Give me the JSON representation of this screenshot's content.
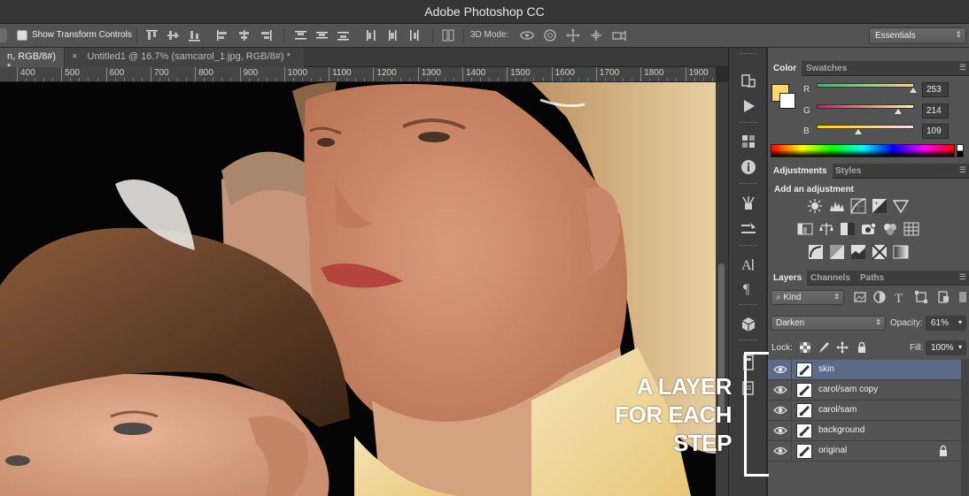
{
  "app": {
    "title": "Adobe Photoshop CC"
  },
  "options_bar": {
    "show_transform_controls": "Show Transform Controls",
    "mode_3d_label": "3D Mode:",
    "workspace": "Essentials"
  },
  "tabs": [
    {
      "label": "n, RGB/8#) *"
    },
    {
      "close": "×",
      "label": "Untitled1 @ 16.7% (samcarol_1.jpg, RGB/8#) *"
    }
  ],
  "ruler": {
    "labels": [
      "400",
      "500",
      "600",
      "700",
      "800",
      "900",
      "1000",
      "1100",
      "1200",
      "1300",
      "1400",
      "1500",
      "1600",
      "1700",
      "1800",
      "1900"
    ]
  },
  "color_panel": {
    "tabs": [
      "Color",
      "Swatches"
    ],
    "foreground": "#fdd66d",
    "background": "#ffffff",
    "channels": [
      {
        "label": "R",
        "value": "253",
        "fraction": 0.99
      },
      {
        "label": "G",
        "value": "214",
        "fraction": 0.84
      },
      {
        "label": "B",
        "value": "109",
        "fraction": 0.43
      }
    ]
  },
  "adjustments_panel": {
    "tabs": [
      "Adjustments",
      "Styles"
    ],
    "heading": "Add an adjustment"
  },
  "layers_panel": {
    "tabs": [
      "Layers",
      "Channels",
      "Paths"
    ],
    "filter_kind": "Kind",
    "blend_mode": "Darken",
    "opacity_label": "Opacity:",
    "opacity_value": "61%",
    "lock_label": "Lock:",
    "fill_label": "Fill:",
    "fill_value": "100%",
    "layers": [
      {
        "name": "skin",
        "selected": true,
        "locked": false
      },
      {
        "name": "carol/sam copy",
        "selected": false,
        "locked": false
      },
      {
        "name": "carol/sam",
        "selected": false,
        "locked": false
      },
      {
        "name": "background",
        "selected": false,
        "locked": false
      },
      {
        "name": "original",
        "selected": false,
        "locked": true
      }
    ]
  },
  "annotation": {
    "lines": [
      "A LAYER",
      "FOR EACH",
      "STEP"
    ]
  },
  "icons": {
    "eye": "eye-icon",
    "brush": "brush-icon",
    "lock": "lock-icon",
    "close": "close-icon",
    "search": "search-icon"
  }
}
